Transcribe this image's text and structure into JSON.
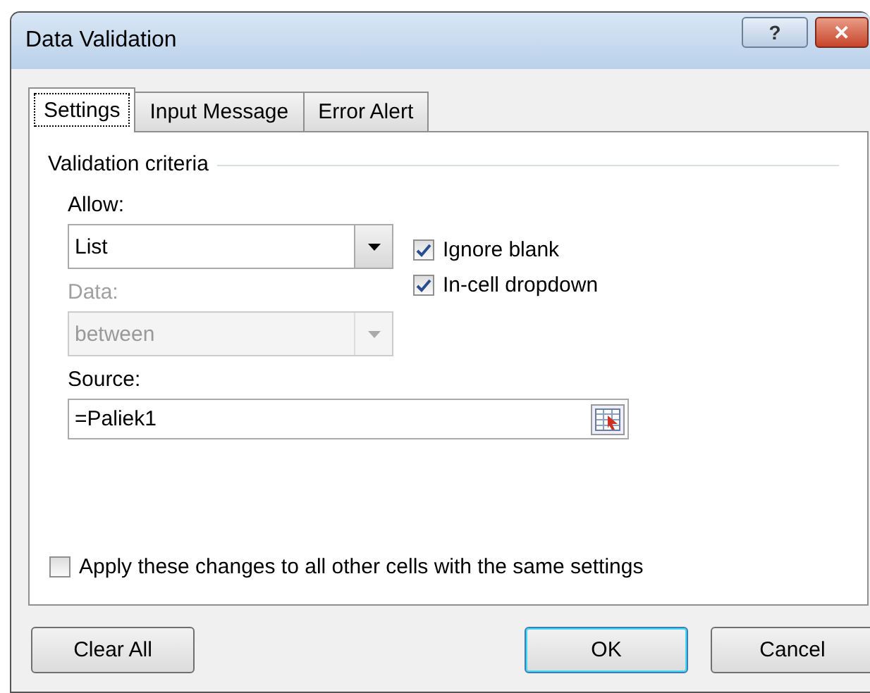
{
  "window": {
    "title": "Data Validation",
    "controls": [
      "?",
      "✕"
    ]
  },
  "tabs": [
    {
      "label": "Settings",
      "selected": true
    },
    {
      "label": "Input Message",
      "selected": false
    },
    {
      "label": "Error Alert",
      "selected": false
    }
  ],
  "group": {
    "title": "Validation criteria"
  },
  "allow": {
    "label": "Allow:",
    "value": "List",
    "disabled": false
  },
  "data": {
    "label": "Data:",
    "value": "between",
    "disabled": true
  },
  "options": [
    {
      "label": "Ignore blank",
      "checked": true
    },
    {
      "label": "In-cell dropdown",
      "checked": true
    }
  ],
  "source": {
    "label": "Source:",
    "value": "=Paliek1"
  },
  "apply_all": {
    "label": "Apply these changes to all other cells with the same settings",
    "checked": false
  },
  "buttons": [
    {
      "label": "Clear All",
      "default": false
    },
    {
      "label": "OK",
      "default": true
    },
    {
      "label": "Cancel",
      "default": false
    }
  ]
}
